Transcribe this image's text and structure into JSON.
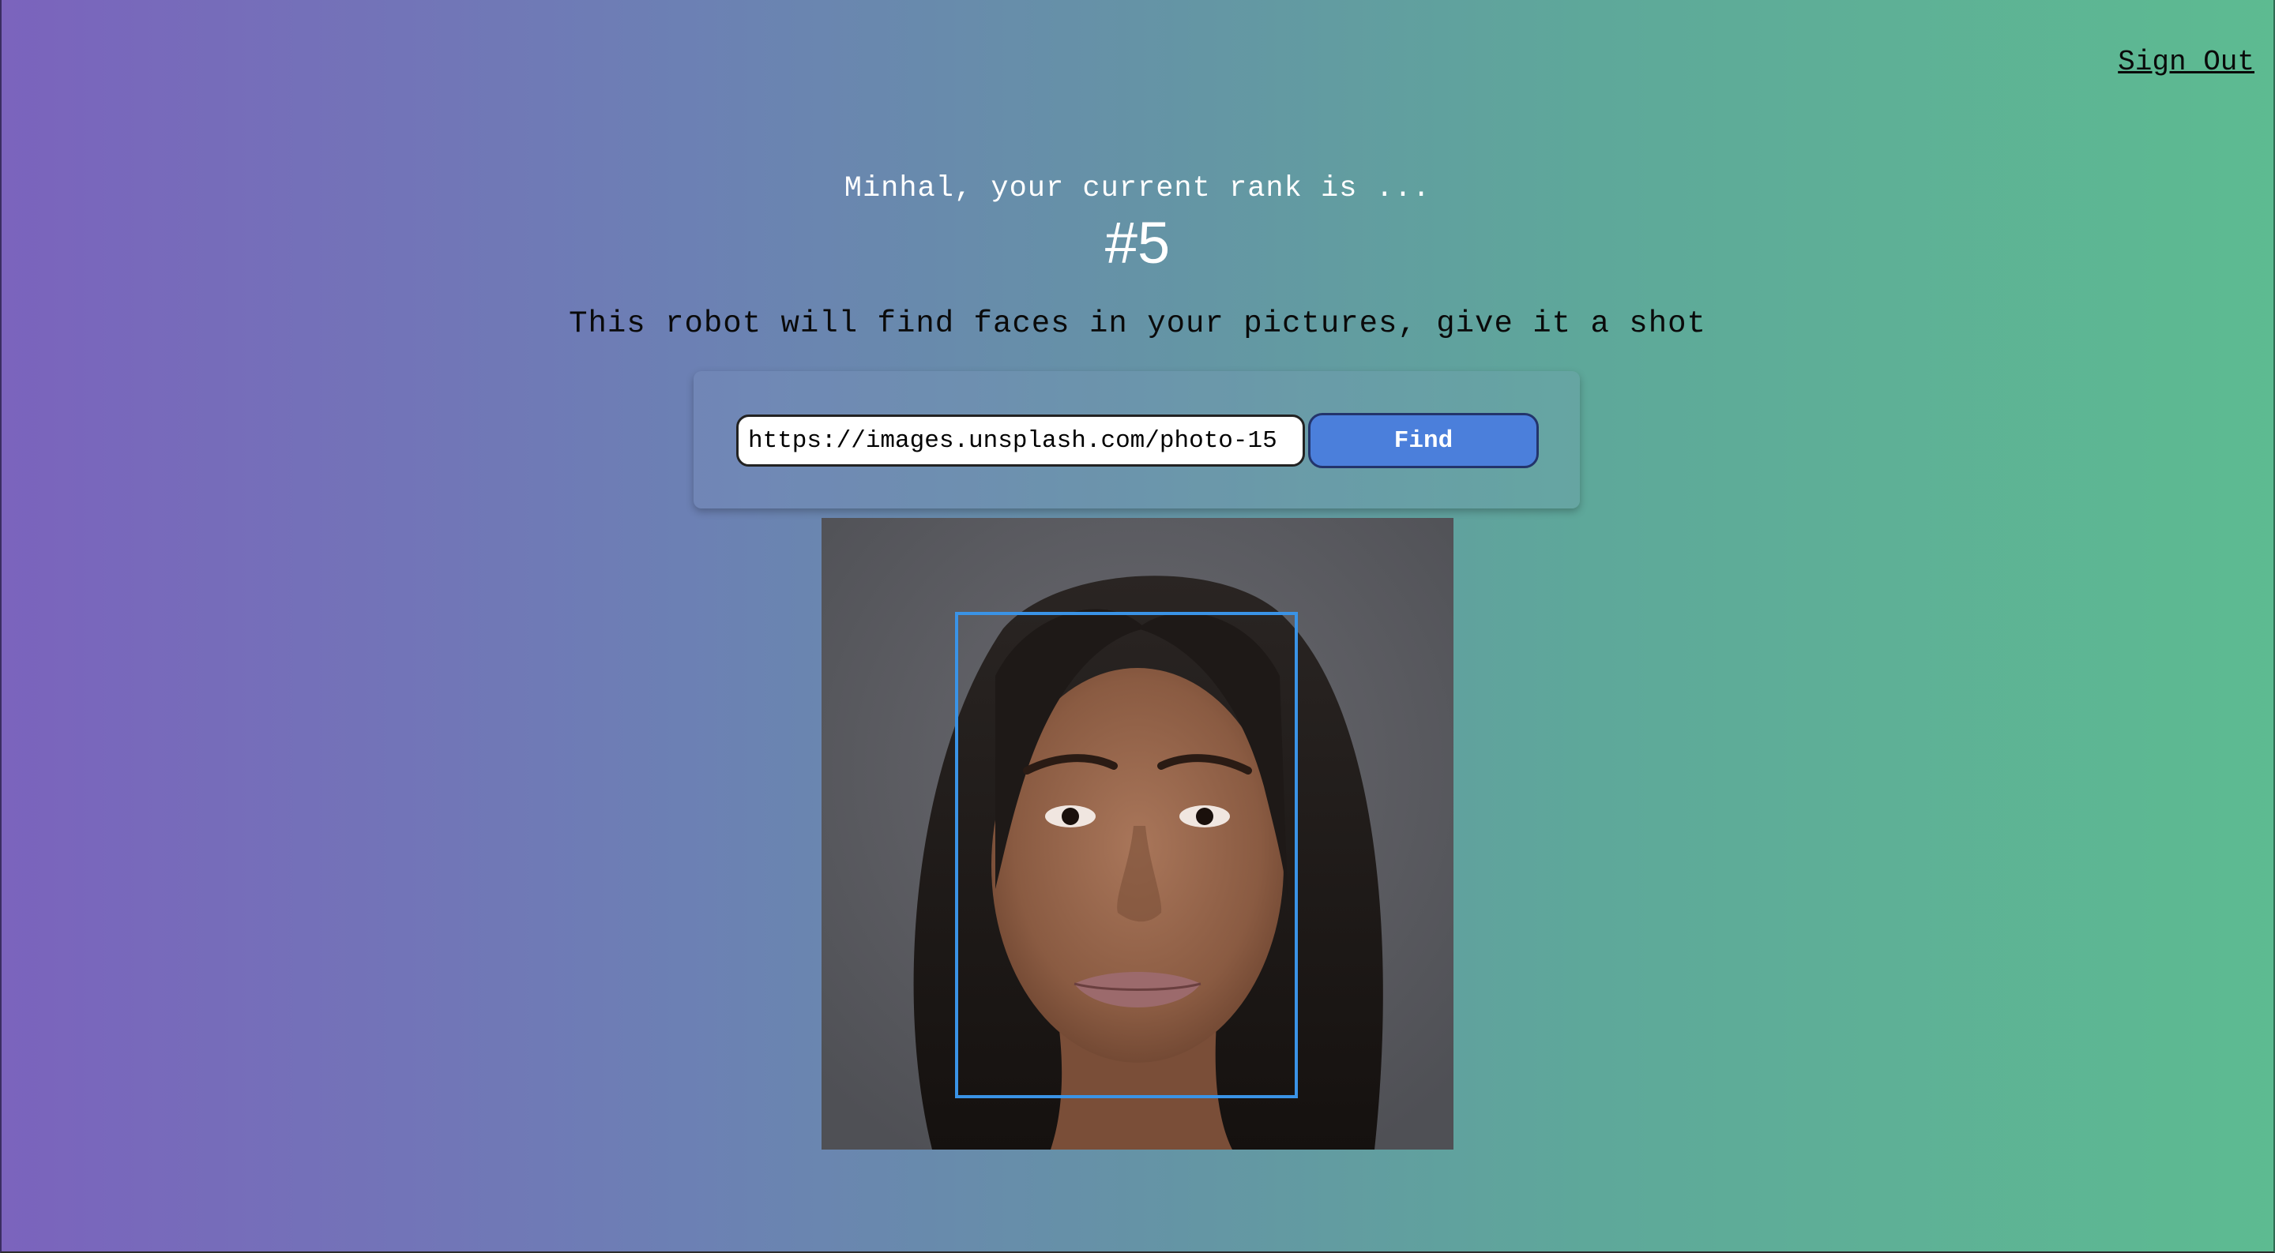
{
  "header": {
    "signout_label": "Sign Out"
  },
  "rank": {
    "greeting": "Minhal, your current rank is ...",
    "value": "#5"
  },
  "tagline": "This robot will find faces in your pictures, give it a shot",
  "form": {
    "url_value": "https://images.unsplash.com/photo-15",
    "find_label": "Find"
  },
  "result": {
    "image_subject": "portrait-face",
    "face_box_color": "#3a93e6"
  },
  "colors": {
    "gradient_start": "#7b63bd",
    "gradient_end": "#5dbb91",
    "button": "#4b7fdb"
  }
}
